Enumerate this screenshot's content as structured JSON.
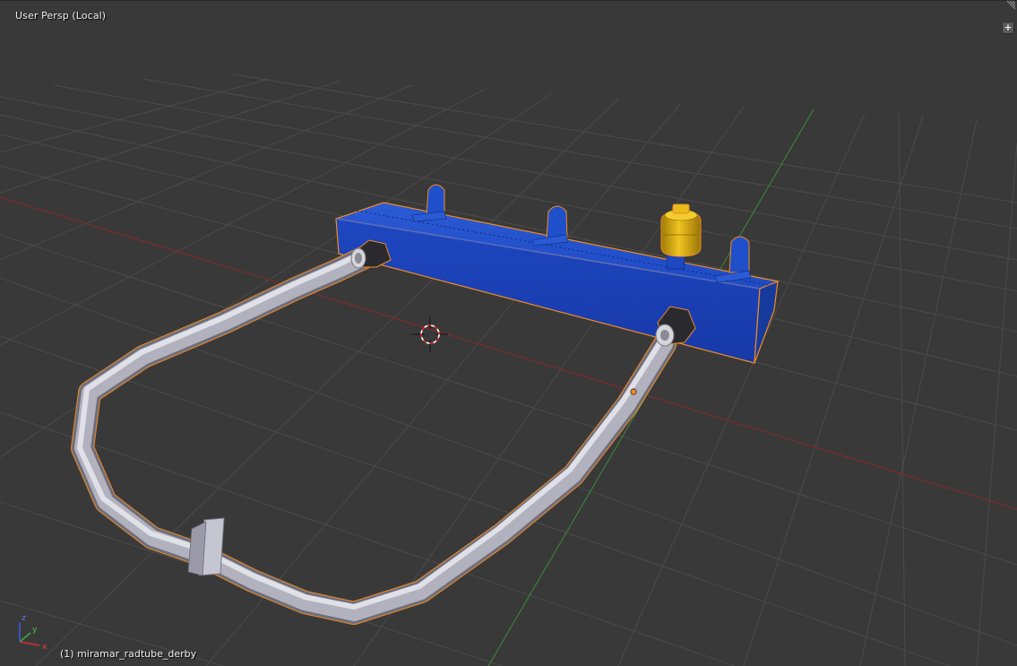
{
  "viewport": {
    "view_label": "User Persp (Local)",
    "object_label": "(1) miramar_radtube_derby",
    "toolshelf_toggle": "+"
  },
  "axes_gizmo": {
    "x": "x",
    "y": "y",
    "z": "z"
  },
  "colors": {
    "background": "#393939",
    "grid": "#4a4a4a",
    "x_axis": "#8b2a2a",
    "y_axis": "#3f8a3f",
    "selection_outline": "#f08a24",
    "rail_blue": "#1f4fc9",
    "tube_gray": "#b8b8c4",
    "cap_gold": "#d8a812"
  }
}
